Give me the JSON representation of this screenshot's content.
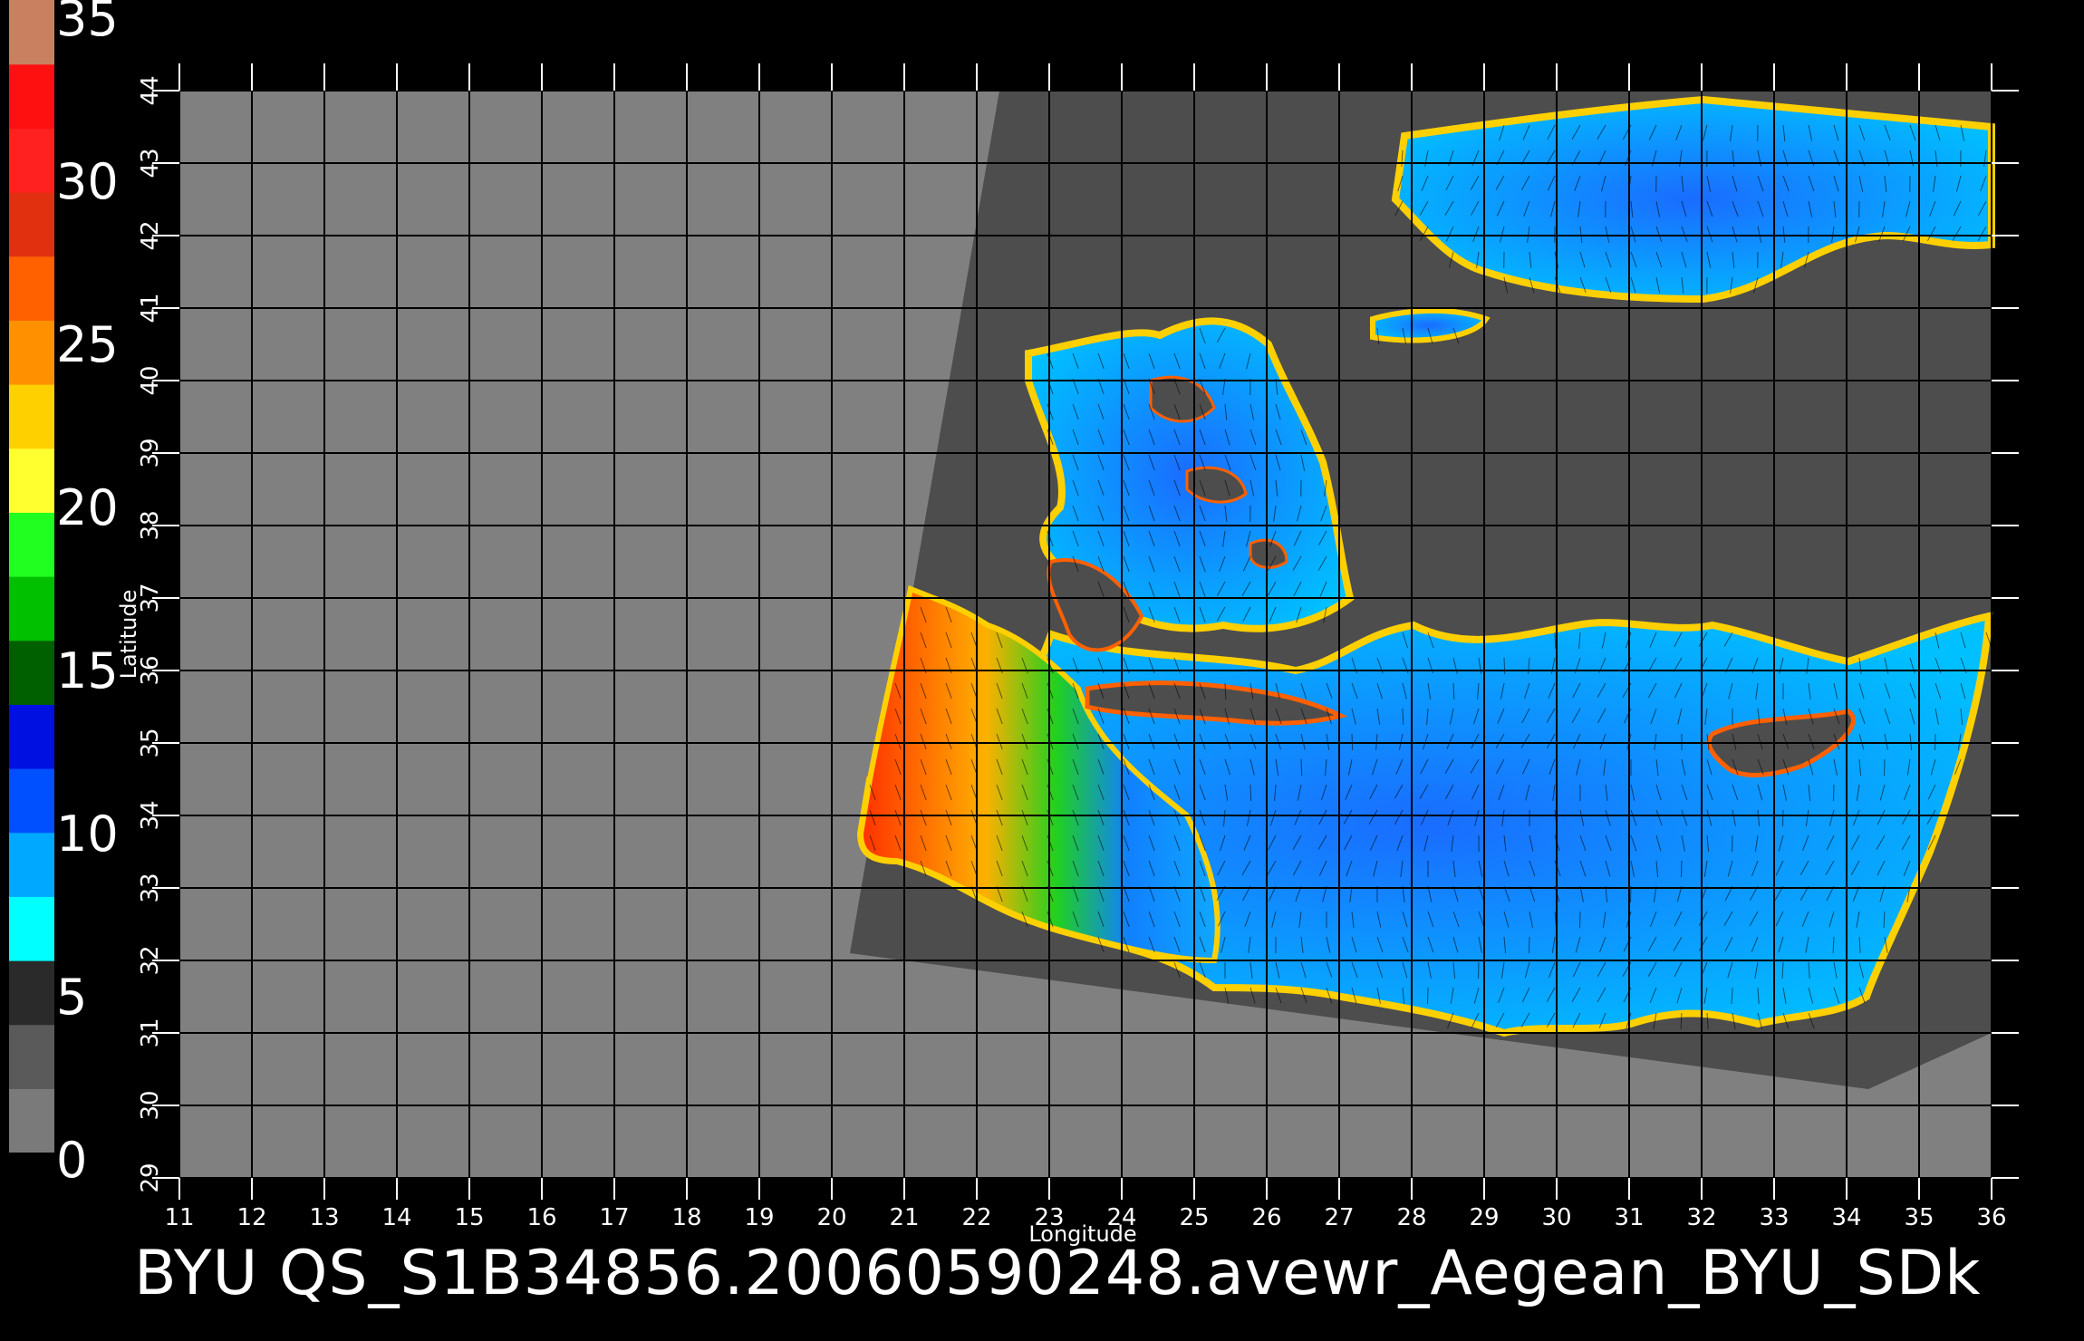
{
  "colorbar": {
    "labels": [
      "35",
      "30",
      "25",
      "20",
      "15",
      "10",
      "5",
      "0"
    ],
    "min": 0,
    "max": 35,
    "colors": [
      "#7a7a7a",
      "#5a5a5a",
      "#2a2a2a",
      "#00ffff",
      "#00a8ff",
      "#0050ff",
      "#0010e0",
      "#006000",
      "#00c000",
      "#20ff20",
      "#ffff30",
      "#ffd000",
      "#ff9000",
      "#ff6000",
      "#e03010",
      "#ff2020",
      "#ff1010",
      "#c88060"
    ]
  },
  "map": {
    "x_axis_title": "Longitude",
    "y_axis_title": "Latitude",
    "lon_ticks": [
      "11",
      "12",
      "13",
      "14",
      "15",
      "16",
      "17",
      "18",
      "19",
      "20",
      "21",
      "22",
      "23",
      "24",
      "25",
      "26",
      "27",
      "28",
      "29",
      "30",
      "31",
      "32",
      "33",
      "34",
      "35",
      "36"
    ],
    "lat_ticks": [
      "29",
      "30",
      "31",
      "32",
      "33",
      "34",
      "35",
      "36",
      "37",
      "38",
      "39",
      "40",
      "41",
      "42",
      "43",
      "44"
    ],
    "lon_range": [
      11,
      36
    ],
    "lat_range": [
      29,
      44
    ],
    "colors": {
      "background": "#808080",
      "swath": "#4d4d4d",
      "land": "#4d4d4d",
      "grid": "#000000",
      "sea_low": "#1e90ff",
      "sea_mid": "#00b4ff",
      "coast": "#ffd000",
      "wind_high": "#ff4000"
    }
  },
  "footer": {
    "text": "BYU  QS_S1B34856.20060590248.avewr_Aegean_BYU_SDk"
  }
}
